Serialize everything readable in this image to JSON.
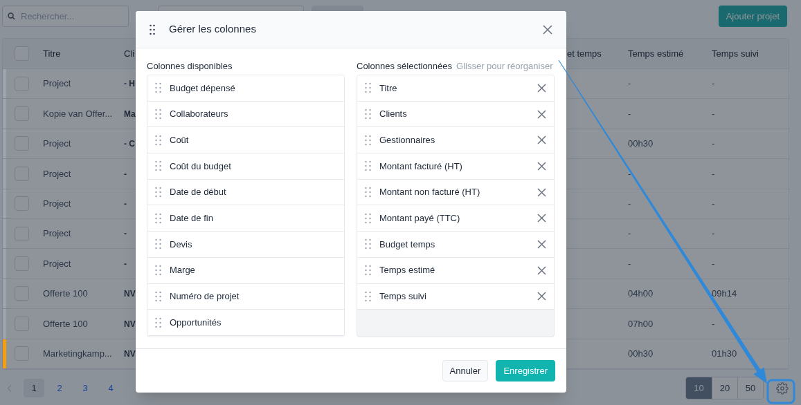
{
  "toolbar": {
    "search": {
      "placeholder": "Rechercher..."
    },
    "add_button": "Ajouter projet"
  },
  "table": {
    "header_checked": false,
    "columns": [
      "Titre",
      "Cli",
      "et temps",
      "Temps estimé",
      "Temps suivi"
    ],
    "rows": [
      {
        "title": "Project",
        "client": "- H",
        "estimated": "-",
        "tracked": "-",
        "checked": false,
        "color": "#9ca3af"
      },
      {
        "title": "Kopie van Offer...",
        "client": "Ma",
        "estimated": "-",
        "tracked": "-",
        "checked": false,
        "color": "#9ca3af"
      },
      {
        "title": "Project",
        "client": "- C",
        "estimated": "00h30",
        "tracked": "-",
        "checked": false,
        "color": "#9ca3af"
      },
      {
        "title": "Project",
        "client": "-",
        "estimated": "-",
        "tracked": "-",
        "checked": false,
        "color": "#9ca3af"
      },
      {
        "title": "Project",
        "client": "-",
        "estimated": "-",
        "tracked": "-",
        "checked": false,
        "color": "#9ca3af"
      },
      {
        "title": "Project",
        "client": "-",
        "estimated": "-",
        "tracked": "-",
        "checked": false,
        "color": "#9ca3af"
      },
      {
        "title": "Project",
        "client": "-",
        "estimated": "-",
        "tracked": "-",
        "checked": false,
        "color": "#9ca3af"
      },
      {
        "title": "Offerte 100",
        "client": "NV",
        "estimated": "04h00",
        "tracked": "09h14",
        "checked": false,
        "color": "#9ca3af"
      },
      {
        "title": "Offerte 100",
        "client": "NV",
        "estimated": "07h00",
        "tracked": "-",
        "checked": false,
        "color": "#9ca3af"
      },
      {
        "title": "Marketingkamp...",
        "client": "NV",
        "estimated": "00h30",
        "tracked": "01h30",
        "checked": false,
        "color": "#f59e0b"
      }
    ]
  },
  "pagination": {
    "pages": [
      {
        "label": "1",
        "selected": true
      },
      {
        "label": "2",
        "selected": false
      },
      {
        "label": "3",
        "selected": false
      },
      {
        "label": "4",
        "selected": false
      }
    ],
    "page_sizes": [
      {
        "label": "10",
        "selected": true
      },
      {
        "label": "20",
        "selected": false
      },
      {
        "label": "50",
        "selected": false
      }
    ]
  },
  "modal": {
    "title": "Gérer les colonnes",
    "available": {
      "label": "Colonnes disponibles",
      "items": [
        "Budget dépensé",
        "Collaborateurs",
        "Coût",
        "Coût du budget",
        "Date de début",
        "Date de fin",
        "Devis",
        "Marge",
        "Numéro de projet",
        "Opportunités"
      ]
    },
    "selected": {
      "label": "Colonnes sélectionnées",
      "hint": "Glisser pour réorganiser",
      "items": [
        "Titre",
        "Clients",
        "Gestionnaires",
        "Montant facturé (HT)",
        "Montant non facturé (HT)",
        "Montant payé (TTC)",
        "Budget temps",
        "Temps estimé",
        "Temps suivi"
      ]
    },
    "cancel": "Annuler",
    "save": "Enregistrer"
  }
}
